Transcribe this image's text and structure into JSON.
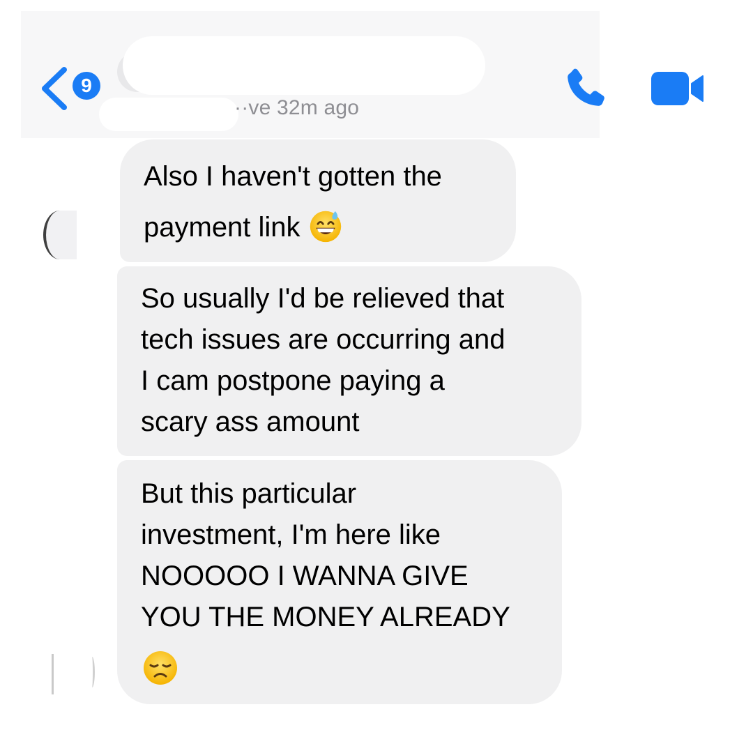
{
  "header": {
    "back": {
      "badge_count": "9",
      "icon": "chevron-left-icon"
    },
    "contact_status": "··ve 32m ago",
    "actions": [
      {
        "icon": "phone-icon"
      },
      {
        "icon": "video-camera-icon"
      }
    ],
    "accent_color": "#1a7cf5"
  },
  "messages": [
    {
      "lines": [
        "Also I haven't gotten the",
        "payment link"
      ],
      "emoji": "grinning-sweat-emoji"
    },
    {
      "lines": [
        "So usually I'd be relieved that",
        "tech issues are occurring and",
        "I cam postpone paying a",
        "scary ass amount"
      ]
    },
    {
      "lines": [
        "But this particular",
        "investment, I'm here like",
        "NOOOOO I WANNA GIVE",
        "YOU THE MONEY ALREADY"
      ],
      "emoji": "disappointed-face-emoji"
    }
  ],
  "colors": {
    "bubble_background": "#f0f0f1",
    "header_background": "#f7f7f8",
    "status_text": "#8e8e93"
  }
}
